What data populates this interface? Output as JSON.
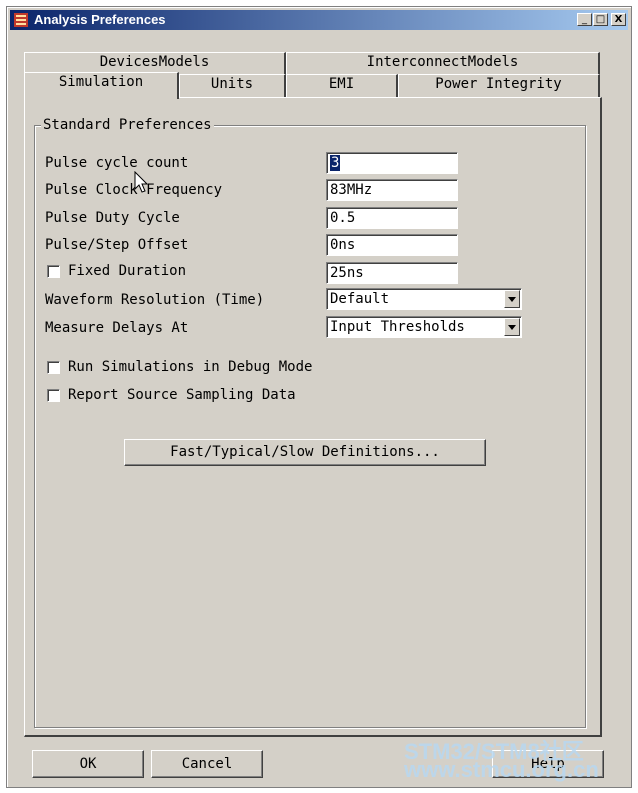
{
  "window": {
    "title": "Analysis Preferences",
    "controls": {
      "minimize": "_",
      "maximize": "□",
      "close": "X"
    }
  },
  "tabs": {
    "back_row": [
      "DevicesModels",
      "InterconnectModels"
    ],
    "front_row": [
      "Simulation",
      "Units",
      "EMI",
      "Power Integrity"
    ],
    "active": "Simulation"
  },
  "group": {
    "title": "Standard Preferences",
    "fields": [
      {
        "label": "Pulse cycle count",
        "value": "3",
        "selected": true
      },
      {
        "label": "Pulse Clock Frequency",
        "value": "83MHz"
      },
      {
        "label": "Pulse Duty Cycle",
        "value": "0.5"
      },
      {
        "label": "Pulse/Step Offset",
        "value": "0ns"
      },
      {
        "label": "Fixed Duration",
        "value": "25ns",
        "checkbox": false
      }
    ],
    "selects": [
      {
        "label": "Waveform Resolution (Time)",
        "value": "Default"
      },
      {
        "label": "Measure Delays At",
        "value": "Input Thresholds"
      }
    ],
    "checkboxes": [
      {
        "label": "Run Simulations in Debug Mode",
        "checked": false
      },
      {
        "label": "Report Source Sampling Data",
        "checked": false
      }
    ],
    "definitions_button": "Fast/Typical/Slow Definitions..."
  },
  "buttons": {
    "ok": "OK",
    "cancel": "Cancel",
    "help": "Help"
  },
  "watermark": {
    "line1": "STM32/STM8社区",
    "line2": "www.stmcu.org.cn"
  },
  "colors": {
    "face": "#d4d0c8",
    "title_start": "#0a246a",
    "title_end": "#a6caf0",
    "selection": "#0a246a"
  }
}
